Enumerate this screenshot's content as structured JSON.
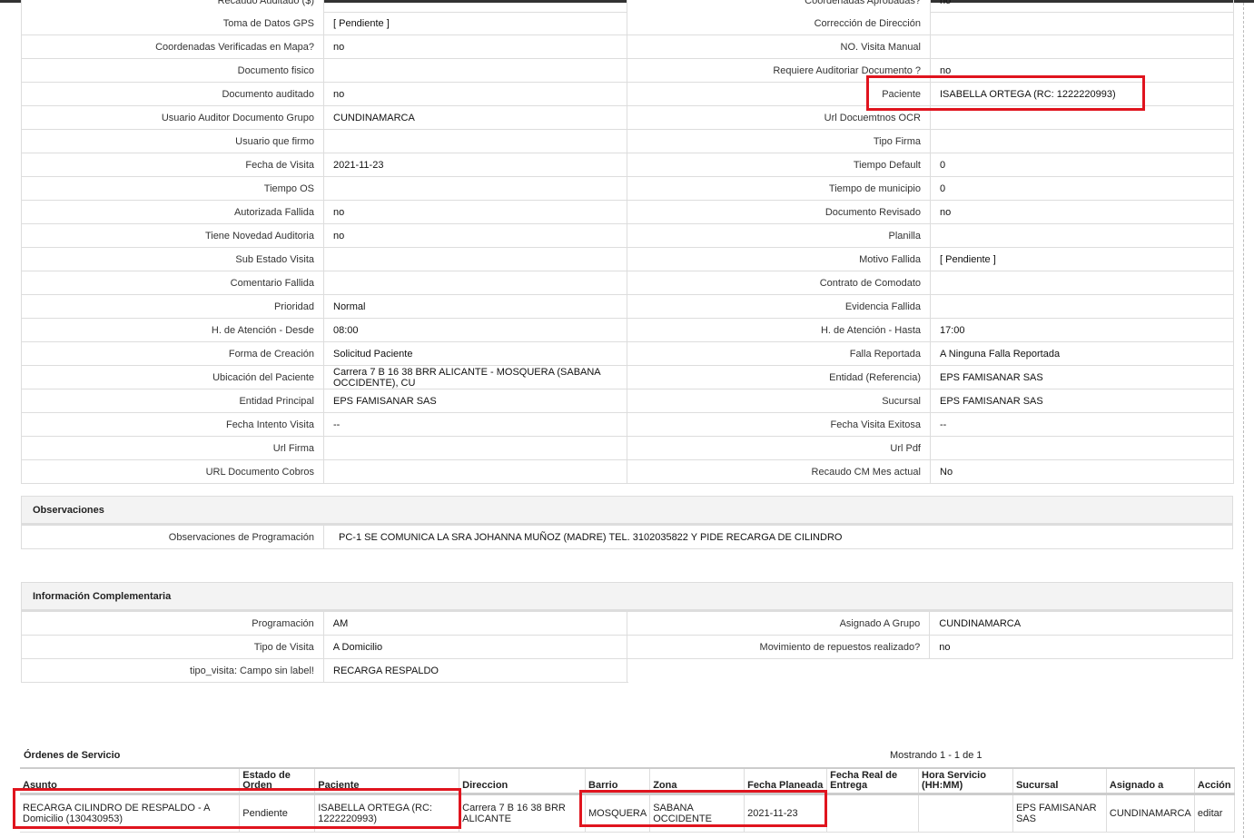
{
  "detail_rows": [
    {
      "l1": "Toma de Datos GPS",
      "v1": "[ Pendiente ]",
      "l2": "Corrección de Dirección",
      "v2": ""
    },
    {
      "l1": "Coordenadas Verificadas en Mapa?",
      "v1": "no",
      "l2": "NO. Visita Manual",
      "v2": ""
    },
    {
      "l1": "Documento fisico",
      "v1": "",
      "l2": "Requiere Auditoriar Documento ?",
      "v2": "no"
    },
    {
      "l1": "Documento auditado",
      "v1": "no",
      "l2": "Paciente",
      "v2": "ISABELLA ORTEGA (RC: 1222220993)"
    },
    {
      "l1": "Usuario Auditor Documento Grupo",
      "v1": "CUNDINAMARCA",
      "l2": "Url Docuemtnos OCR",
      "v2": ""
    },
    {
      "l1": "Usuario que firmo",
      "v1": "",
      "l2": "Tipo Firma",
      "v2": ""
    },
    {
      "l1": "Fecha de Visita",
      "v1": "2021-11-23",
      "l2": "Tiempo Default",
      "v2": "0"
    },
    {
      "l1": "Tiempo OS",
      "v1": "",
      "l2": "Tiempo de municipio",
      "v2": "0"
    },
    {
      "l1": "Autorizada Fallida",
      "v1": "no",
      "l2": "Documento Revisado",
      "v2": "no"
    },
    {
      "l1": "Tiene Novedad Auditoria",
      "v1": "no",
      "l2": "Planilla",
      "v2": ""
    },
    {
      "l1": "Sub Estado Visita",
      "v1": "",
      "l2": "Motivo Fallida",
      "v2": "[ Pendiente ]"
    },
    {
      "l1": "Comentario Fallida",
      "v1": "",
      "l2": "Contrato de Comodato",
      "v2": ""
    },
    {
      "l1": "Prioridad",
      "v1": "Normal",
      "l2": "Evidencia Fallida",
      "v2": ""
    },
    {
      "l1": "H. de Atención - Desde",
      "v1": "08:00",
      "l2": "H. de Atención - Hasta",
      "v2": "17:00"
    },
    {
      "l1": "Forma de Creación",
      "v1": "Solicitud Paciente",
      "l2": "Falla Reportada",
      "v2": "A Ninguna Falla Reportada"
    },
    {
      "l1": "Ubicación del Paciente",
      "v1": "Carrera 7 B 16 38 BRR ALICANTE - MOSQUERA (SABANA OCCIDENTE), CU",
      "l2": "Entidad (Referencia)",
      "v2": "EPS FAMISANAR SAS"
    },
    {
      "l1": "Entidad Principal",
      "v1": "EPS FAMISANAR SAS",
      "l2": "Sucursal",
      "v2": "EPS FAMISANAR SAS"
    },
    {
      "l1": "Fecha Intento Visita",
      "v1": "--",
      "l2": "Fecha Visita Exitosa",
      "v2": "--"
    },
    {
      "l1": "Url Firma",
      "v1": "",
      "l2": "Url Pdf",
      "v2": ""
    },
    {
      "l1": "URL Documento Cobros",
      "v1": "",
      "l2": "Recaudo CM Mes actual",
      "v2": "No"
    }
  ],
  "cut_top": {
    "l1": "Recaudo Auditado ($)",
    "v1": "",
    "l2": "Coordenadas Aprobadas?",
    "v2": "no"
  },
  "observaciones": {
    "title": "Observaciones",
    "label": "Observaciones de Programación",
    "value": "PC-1 SE COMUNICA LA SRA JOHANNA MUÑOZ (MADRE) TEL. 3102035822 Y PIDE RECARGA DE CILINDRO"
  },
  "complementaria": {
    "title": "Información Complementaria",
    "rows": [
      {
        "l1": "Programación",
        "v1": "AM",
        "l2": "Asignado A Grupo",
        "v2": "CUNDINAMARCA"
      },
      {
        "l1": "Tipo de Visita",
        "v1": "A Domicilio",
        "l2": "Movimiento de repuestos realizado?",
        "v2": "no"
      },
      {
        "l1": "tipo_visita: Campo sin label!",
        "v1": "RECARGA RESPALDO"
      }
    ]
  },
  "ordenes": {
    "title": "Órdenes de Servicio",
    "count": "Mostrando 1 - 1 de 1",
    "headers": [
      "Asunto",
      "Estado de Orden",
      "Paciente",
      "Direccion",
      "Barrio",
      "Zona",
      "Fecha Planeada",
      "Fecha Real de Entrega",
      "Hora Servicio (HH:MM)",
      "Sucursal",
      "Asignado a",
      "Acción"
    ],
    "row": {
      "asunto": "RECARGA CILINDRO DE RESPALDO - A Domicilio (130430953)",
      "estado": "Pendiente",
      "paciente": "ISABELLA ORTEGA (RC: 1222220993)",
      "direccion": "Carrera 7 B 16 38 BRR ALICANTE",
      "barrio": "MOSQUERA",
      "zona": "SABANA OCCIDENTE",
      "fecha": "2021-11-23",
      "fecha_real": "",
      "hora": "",
      "sucursal": "EPS FAMISANAR SAS",
      "asignado": "CUNDINAMARCA",
      "accion": "editar"
    }
  },
  "highlight_color": "#e0141e"
}
